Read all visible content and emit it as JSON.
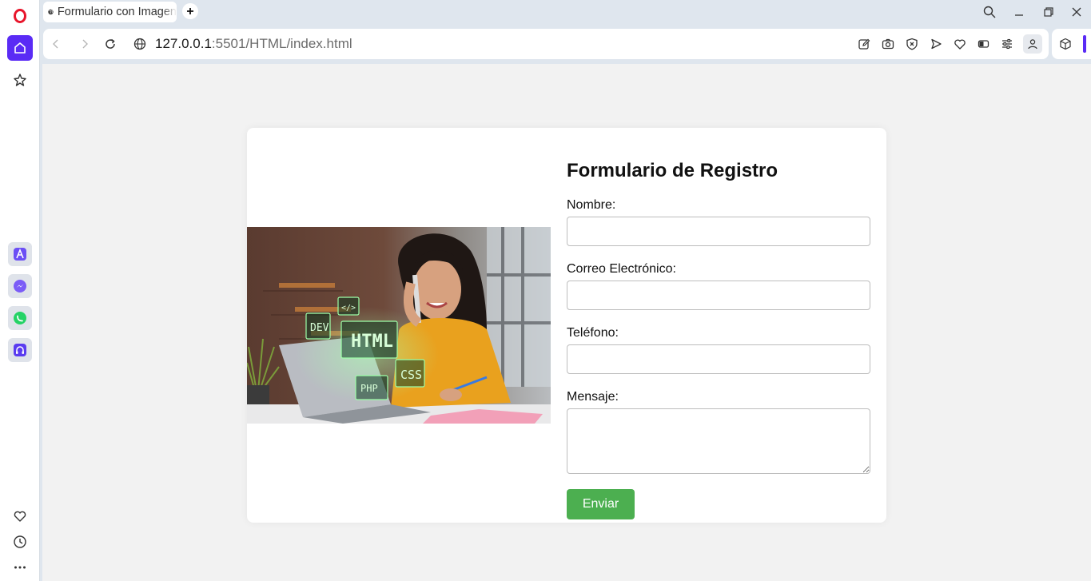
{
  "browser": {
    "tab_title": "Formulario con Imagen",
    "url_host": "127.0.0.1",
    "url_rest": ":5501/HTML/index.html",
    "accent_color": "#5a2bf5"
  },
  "sidebar": {
    "icons": [
      "opera-logo-icon",
      "home-icon",
      "pinboard-icon",
      "aria-icon",
      "messenger-icon",
      "whatsapp-icon",
      "music-player-icon",
      "heart-icon",
      "history-icon",
      "more-icon"
    ]
  },
  "form": {
    "title": "Formulario de Registro",
    "fields": {
      "nombre": {
        "label": "Nombre:",
        "value": ""
      },
      "correo": {
        "label": "Correo Electrónico:",
        "value": ""
      },
      "telefono": {
        "label": "Teléfono:",
        "value": ""
      },
      "mensaje": {
        "label": "Mensaje:",
        "value": ""
      }
    },
    "submit_label": "Enviar",
    "submit_color": "#4caf50"
  },
  "photo": {
    "overlay_texts": [
      "</>",
      "DEV",
      "HTML",
      "CSS",
      "PHP"
    ]
  }
}
